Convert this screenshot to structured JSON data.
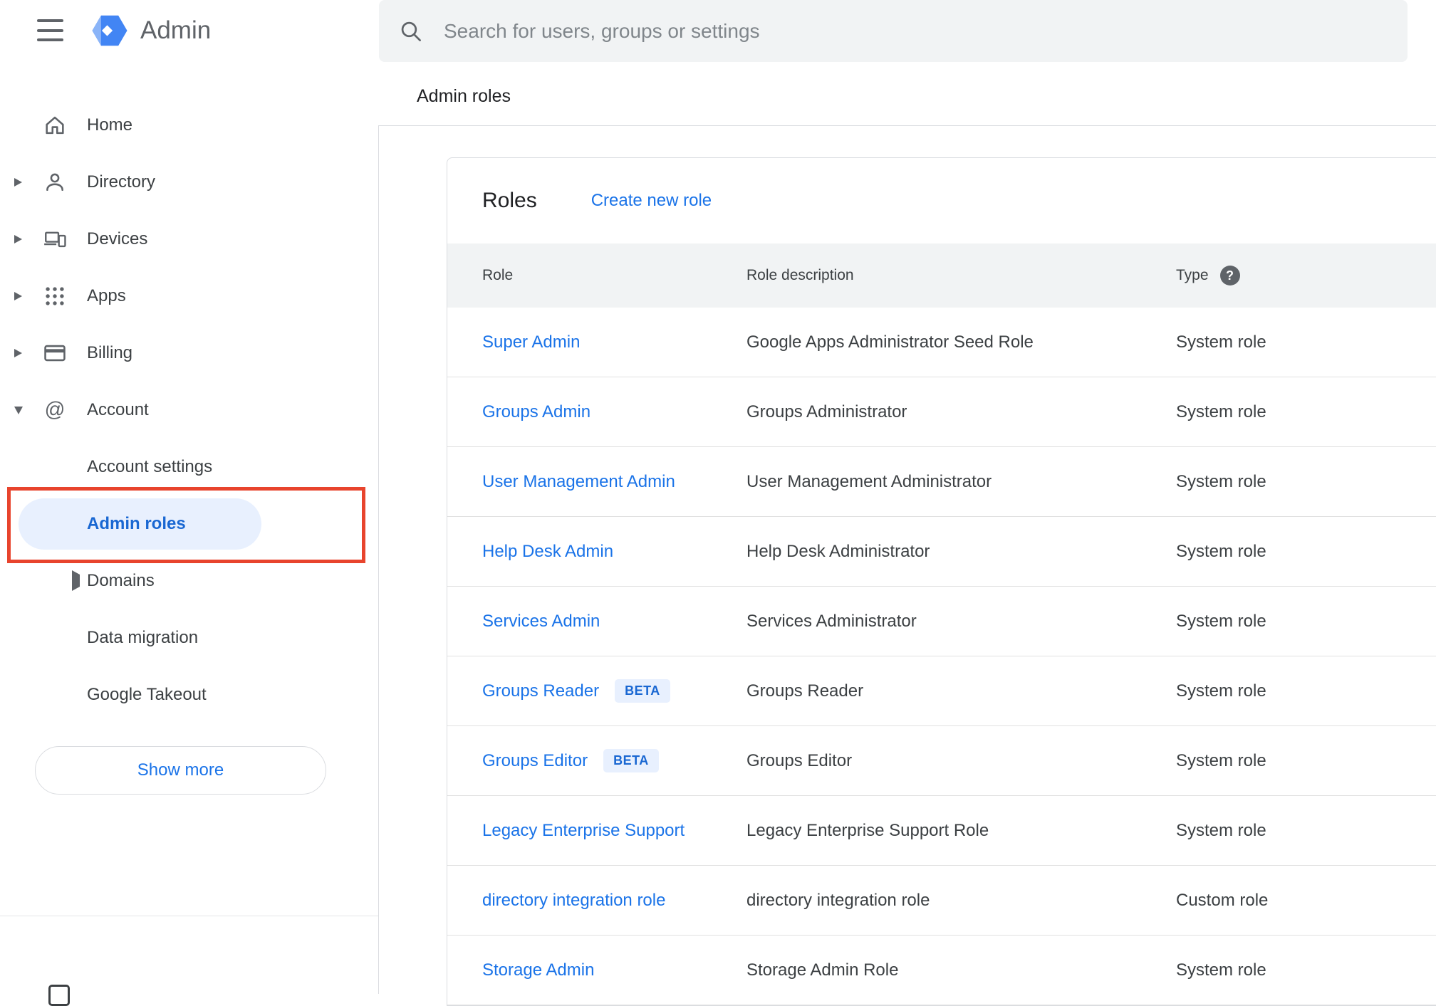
{
  "header": {
    "app_name": "Admin",
    "search": {
      "placeholder": "Search for users, groups or settings"
    },
    "page_title": "Admin roles"
  },
  "icons": {
    "help_glyph": "?"
  },
  "sidebar": {
    "items": [
      {
        "label": "Home",
        "icon": "home",
        "arrow": "none"
      },
      {
        "label": "Directory",
        "icon": "person",
        "arrow": "right"
      },
      {
        "label": "Devices",
        "icon": "devices",
        "arrow": "right"
      },
      {
        "label": "Apps",
        "icon": "apps",
        "arrow": "right"
      },
      {
        "label": "Billing",
        "icon": "billing",
        "arrow": "right"
      },
      {
        "label": "Account",
        "icon": "at",
        "arrow": "down"
      }
    ],
    "sub_items": [
      {
        "label": "Account settings",
        "arrow": "none",
        "selected": false
      },
      {
        "label": "Admin roles",
        "arrow": "none",
        "selected": true
      },
      {
        "label": "Domains",
        "arrow": "right",
        "selected": false
      },
      {
        "label": "Data migration",
        "arrow": "none",
        "selected": false
      },
      {
        "label": "Google Takeout",
        "arrow": "none",
        "selected": false
      }
    ],
    "show_more_label": "Show more"
  },
  "roles_card": {
    "title": "Roles",
    "create_link_label": "Create new role",
    "table": {
      "columns": [
        "Role",
        "Role description",
        "Type"
      ],
      "beta_label": "BETA",
      "rows": [
        {
          "role": "Super Admin",
          "beta": false,
          "description": "Google Apps Administrator Seed Role",
          "type": "System role"
        },
        {
          "role": "Groups Admin",
          "beta": false,
          "description": "Groups Administrator",
          "type": "System role"
        },
        {
          "role": "User Management Admin",
          "beta": false,
          "description": "User Management Administrator",
          "type": "System role"
        },
        {
          "role": "Help Desk Admin",
          "beta": false,
          "description": "Help Desk Administrator",
          "type": "System role"
        },
        {
          "role": "Services Admin",
          "beta": false,
          "description": "Services Administrator",
          "type": "System role"
        },
        {
          "role": "Groups Reader",
          "beta": true,
          "description": "Groups Reader",
          "type": "System role"
        },
        {
          "role": "Groups Editor",
          "beta": true,
          "description": "Groups Editor",
          "type": "System role"
        },
        {
          "role": "Legacy Enterprise Support",
          "beta": false,
          "description": "Legacy Enterprise Support Role",
          "type": "System role"
        },
        {
          "role": "directory integration role",
          "beta": false,
          "description": "directory integration role",
          "type": "Custom role"
        },
        {
          "role": "Storage Admin",
          "beta": false,
          "description": "Storage Admin Role",
          "type": "System role"
        }
      ]
    }
  },
  "annotation": {
    "highlight_color": "#e8442d"
  },
  "colors": {
    "accent_blue": "#1a73e8",
    "selected_blue": "#1967d2",
    "selected_bg": "#e8f0fe",
    "table_header_bg": "#f1f3f4"
  }
}
